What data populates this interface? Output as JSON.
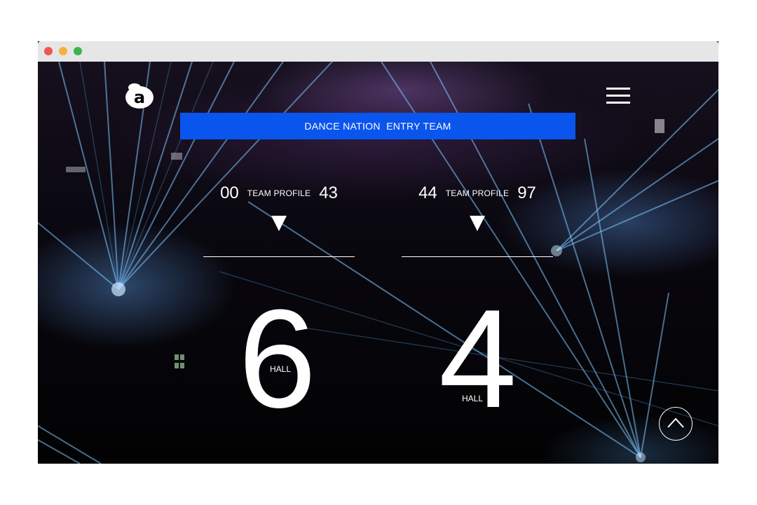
{
  "banner": {
    "label": "DANCE NATION  ENTRY TEAM"
  },
  "groups": [
    {
      "start": "00",
      "label": "TEAM PROFILE",
      "end": "43",
      "hall_number": "6",
      "hall_label": "HALL"
    },
    {
      "start": "44",
      "label": "TEAM PROFILE",
      "end": "97",
      "hall_number": "4",
      "hall_label": "HALL"
    }
  ],
  "icons": {
    "logo": "brand-logo-icon",
    "menu": "hamburger-menu-icon",
    "expand": "triangle-down-icon",
    "scroll_top": "chevron-up-icon"
  },
  "colors": {
    "banner": "#0a55ee",
    "background": "#000000",
    "text": "#ffffff"
  }
}
